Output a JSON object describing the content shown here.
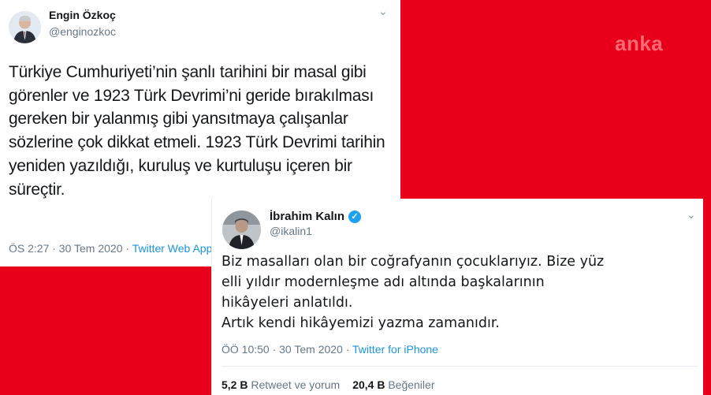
{
  "brand": {
    "text": "anka"
  },
  "tweet1": {
    "name": "Engin Özkoç",
    "handle": "@enginozkoc",
    "text": "Türkiye Cumhuriyeti’nin şanlı tarihini bir masal gibi\ngörenler ve 1923 Türk Devrimi’ni geride bırakılması\ngereken bir yalanmış gibi yansıtmaya çalışanlar\nsözlerine çok dikkat etmeli. 1923 Türk Devrimi tarihin\nyeniden yazıldığı, kuruluş ve kurtuluşu içeren bir\nsüreçtir.",
    "time": "ÖS 2:27 · 30 Tem 2020 · ",
    "source": "Twitter Web App"
  },
  "tweet2": {
    "name": "İbrahim Kalın",
    "handle": "@ikalin1",
    "text": "Biz masalları olan bir coğrafyanın çocuklarıyız. Bize yüz\nelli yıldır modernleşme adı altında başkalarının\nhikâyeleri anlatıldı.\nArtık kendi hikâyemizi yazma zamanıdır.",
    "time": "ÖÖ 10:50 · 30 Tem 2020 · ",
    "source": "Twitter for iPhone",
    "retweets_count": "5,2 B",
    "retweets_label": "Retweet ve yorum",
    "likes_count": "20,4 B",
    "likes_label": "Beğeniler"
  },
  "colors": {
    "background": "#e8001a",
    "link": "#1b95e0",
    "verified": "#1da1f2"
  },
  "icons": {
    "menu": "chevron-down-icon",
    "verified": "verified-badge-icon"
  }
}
